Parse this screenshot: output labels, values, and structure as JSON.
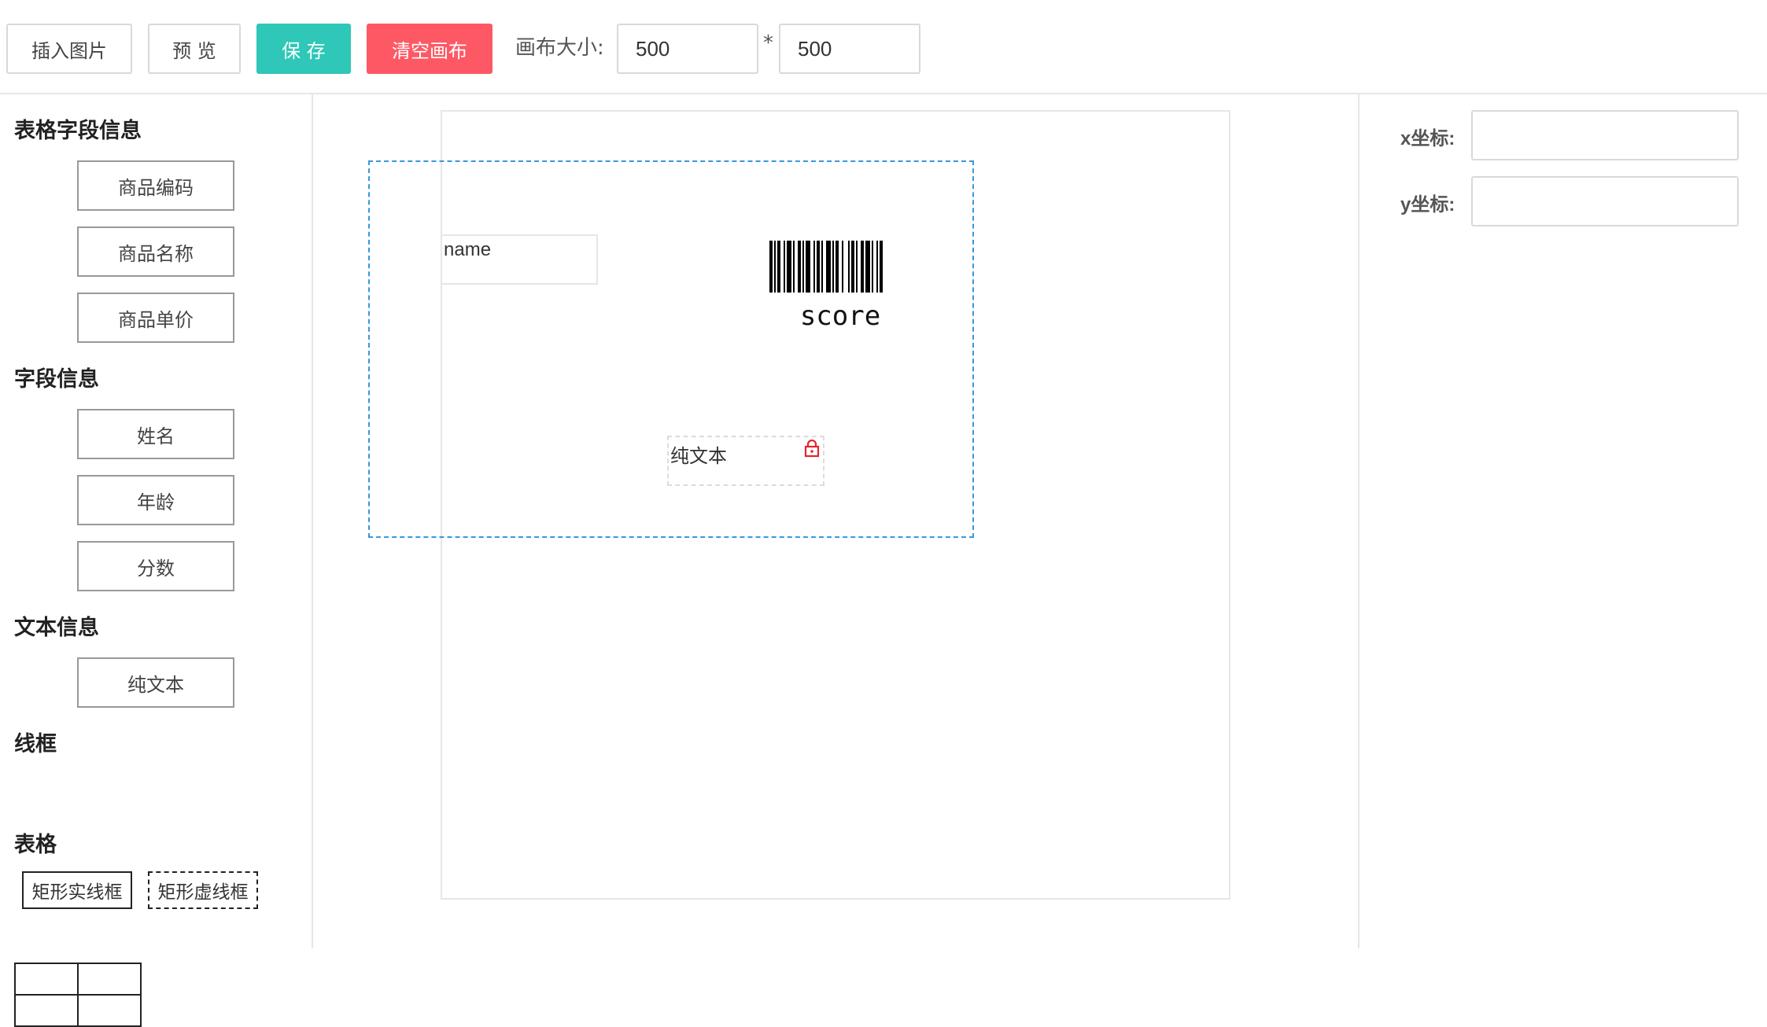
{
  "toolbar": {
    "insert_image": "插入图片",
    "preview": "预 览",
    "save": "保 存",
    "clear_canvas": "清空画布",
    "canvas_size_label": "画布大小:",
    "width_value": "500",
    "times": "*",
    "height_value": "500"
  },
  "left_panel": {
    "table_fields_title": "表格字段信息",
    "table_fields": [
      "商品编码",
      "商品名称",
      "商品单价"
    ],
    "fields_title": "字段信息",
    "fields": [
      "姓名",
      "年龄",
      "分数"
    ],
    "text_title": "文本信息",
    "text_items": [
      "纯文本"
    ],
    "frame_title": "线框",
    "frame_solid": "矩形实线框",
    "frame_dashed": "矩形虚线框",
    "table_title": "表格"
  },
  "canvas": {
    "name_item": "name",
    "barcode_item": "score",
    "text_item": "纯文本",
    "lock_icon": "lock-icon",
    "lock_color": "#e5242f"
  },
  "properties": {
    "x_label": "x坐标:",
    "y_label": "y坐标:",
    "x_value": "",
    "y_value": ""
  },
  "colors": {
    "save_button": "#2ec7b8",
    "clear_button": "#fe5864",
    "selection_border": "#3a97d9"
  }
}
